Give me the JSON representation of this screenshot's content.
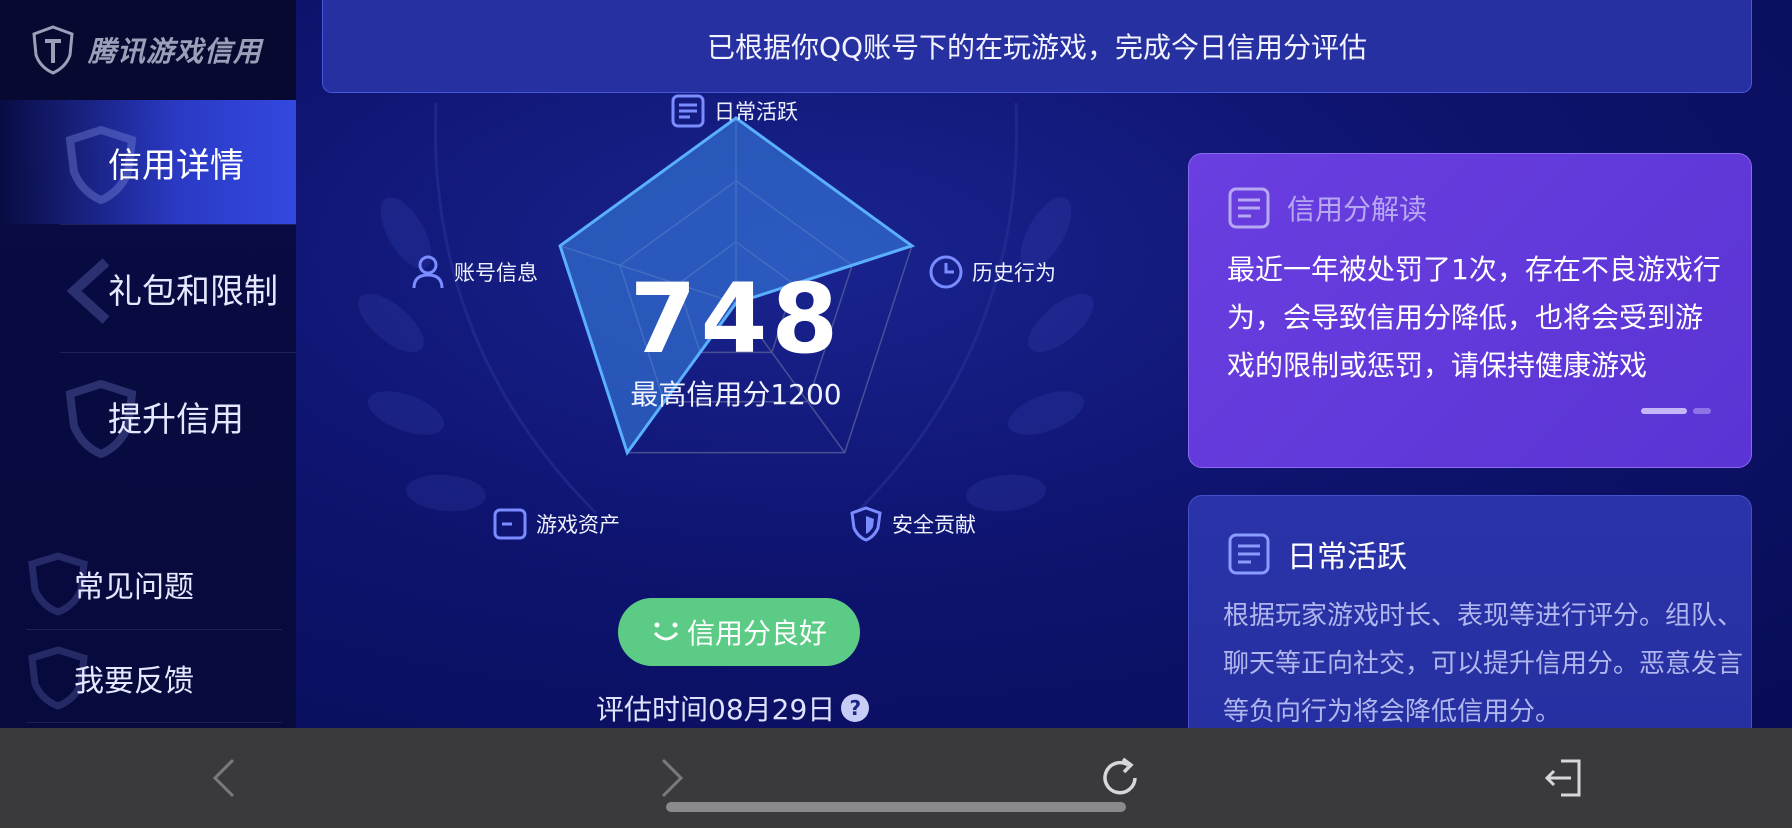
{
  "app": {
    "logo_text": "腾讯游戏信用"
  },
  "sidebar": {
    "items": [
      {
        "label": "信用详情",
        "active": true
      },
      {
        "label": "礼包和限制",
        "active": false
      },
      {
        "label": "提升信用",
        "active": false
      }
    ],
    "footer_items": [
      {
        "label": "常见问题"
      },
      {
        "label": "我要反馈"
      }
    ]
  },
  "banner": {
    "text": "已根据你QQ账号下的在玩游戏，完成今日信用分评估"
  },
  "score": {
    "value": "748",
    "max_label": "最高信用分1200",
    "status": "信用分良好",
    "eval_time": "评估时间08月29日",
    "help": "?"
  },
  "radar": {
    "axes": [
      {
        "label": "日常活跃",
        "icon": "document-icon",
        "value": 1.0
      },
      {
        "label": "历史行为",
        "icon": "clock-icon",
        "value": 1.0
      },
      {
        "label": "安全贡献",
        "icon": "shield-icon",
        "value": 0.0
      },
      {
        "label": "游戏资产",
        "icon": "wallet-icon",
        "value": 1.0
      },
      {
        "label": "账号信息",
        "icon": "user-icon",
        "value": 1.0
      }
    ],
    "colors": {
      "fill": "#3b86e8",
      "stroke": "#5ab0ff",
      "grid": "#4a5096"
    }
  },
  "cards": {
    "interpretation": {
      "title": "信用分解读",
      "body": "最近一年被处罚了1次，存在不良游戏行为，会导致信用分降低，也将会受到游戏的限制或惩罚，请保持健康游戏"
    },
    "daily": {
      "title": "日常活跃",
      "body": "根据玩家游戏时长、表现等进行评分。组队、聊天等正向社交，可以提升信用分。恶意发言等负向行为将会降低信用分。"
    }
  },
  "browser_bar": {
    "buttons": [
      "back-icon",
      "forward-icon",
      "refresh-icon",
      "exit-icon"
    ]
  }
}
